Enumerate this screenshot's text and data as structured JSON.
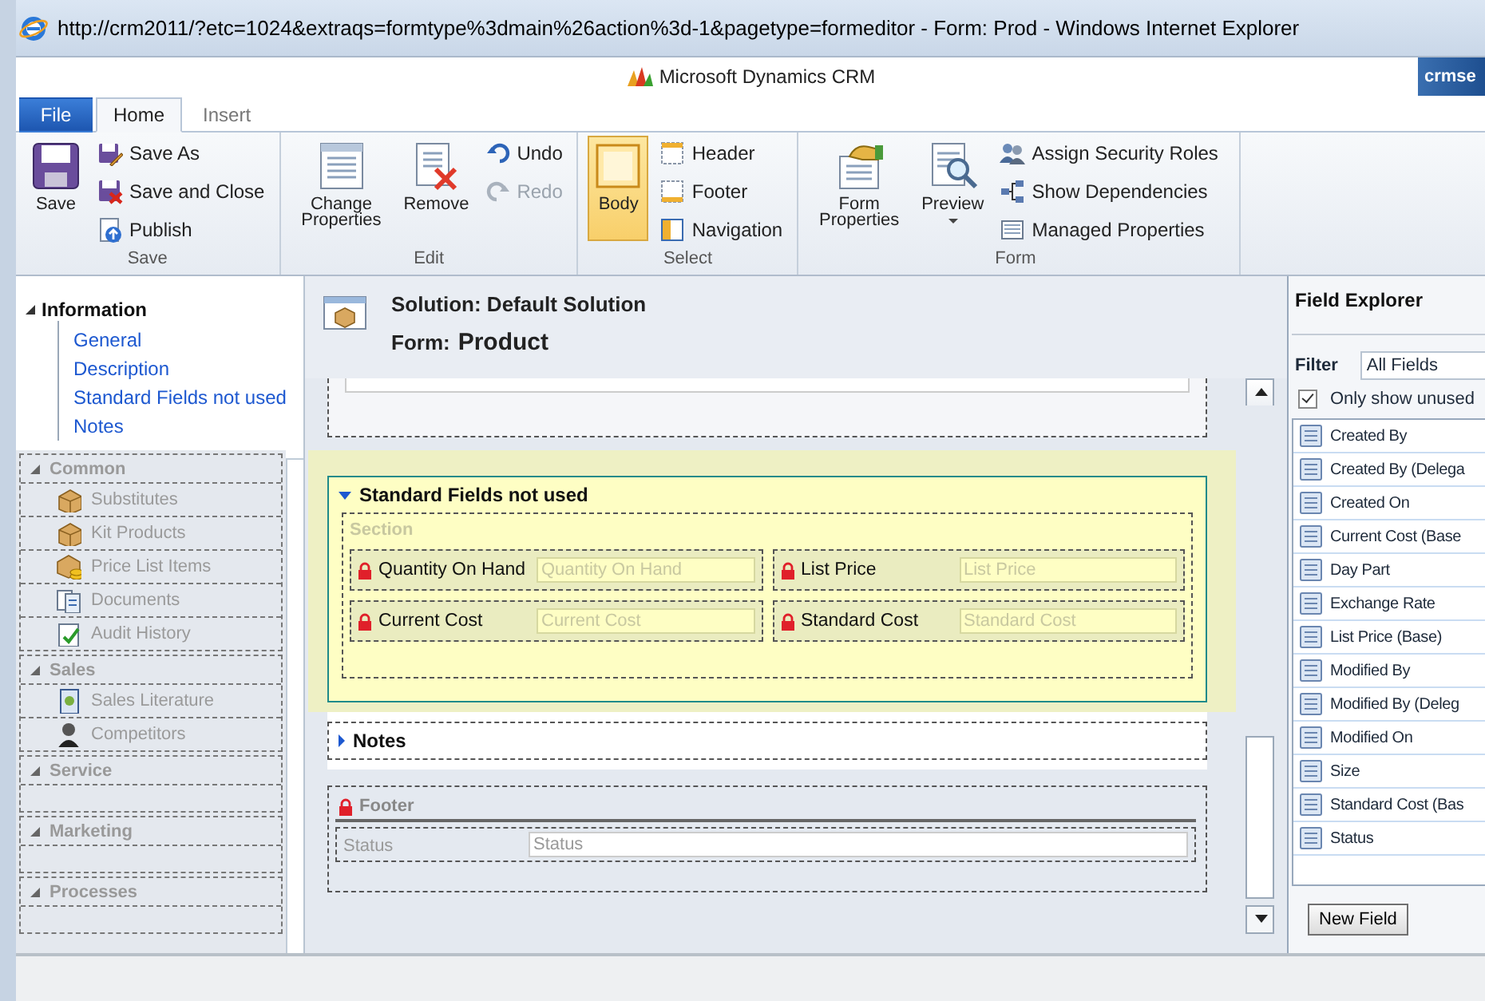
{
  "window": {
    "title": "http://crm2011/?etc=1024&extraqs=formtype%3dmain%26action%3d-1&pagetype=formeditor - Form: Prod - Windows Internet Explorer"
  },
  "header": {
    "product": "Microsoft Dynamics CRM",
    "user": "crmse"
  },
  "ribbon_tabs": [
    {
      "label": "File",
      "kind": "file",
      "selected": false
    },
    {
      "label": "Home",
      "kind": "tab",
      "selected": true
    },
    {
      "label": "Insert",
      "kind": "tab",
      "selected": false
    }
  ],
  "ribbon_groups": [
    {
      "label": "Save",
      "commands": [
        {
          "label": "Save",
          "kind": "large"
        },
        {
          "label": "Save As",
          "kind": "small"
        },
        {
          "label": "Save and Close",
          "kind": "small"
        },
        {
          "label": "Publish",
          "kind": "small"
        }
      ]
    },
    {
      "label": "Edit",
      "commands": [
        {
          "label": "Change Properties",
          "kind": "large"
        },
        {
          "label": "Remove",
          "kind": "large"
        },
        {
          "label": "Undo",
          "kind": "small",
          "disabled": false
        },
        {
          "label": "Redo",
          "kind": "small",
          "disabled": true
        }
      ]
    },
    {
      "label": "Select",
      "commands": [
        {
          "label": "Body",
          "kind": "large",
          "selected": true
        },
        {
          "label": "Header",
          "kind": "small",
          "selected": false
        },
        {
          "label": "Footer",
          "kind": "small",
          "selected": false
        },
        {
          "label": "Navigation",
          "kind": "small",
          "selected": false
        }
      ]
    },
    {
      "label": "Form",
      "commands": [
        {
          "label": "Form Properties",
          "kind": "large"
        },
        {
          "label": "Preview",
          "kind": "large",
          "dropdown": true
        },
        {
          "label": "Assign Security Roles",
          "kind": "small"
        },
        {
          "label": "Show Dependencies",
          "kind": "small"
        },
        {
          "label": "Managed Properties",
          "kind": "small"
        }
      ]
    }
  ],
  "nav_tree": {
    "label": "Information",
    "expanded": true,
    "children": [
      {
        "label": "General"
      },
      {
        "label": "Description"
      },
      {
        "label": "Standard Fields not used"
      },
      {
        "label": "Notes"
      }
    ]
  },
  "nav_groups": [
    {
      "label": "Common",
      "items": [
        {
          "label": "Substitutes"
        },
        {
          "label": "Kit Products"
        },
        {
          "label": "Price List Items"
        },
        {
          "label": "Documents"
        },
        {
          "label": "Audit History"
        }
      ]
    },
    {
      "label": "Sales",
      "items": [
        {
          "label": "Sales Literature"
        },
        {
          "label": "Competitors"
        }
      ]
    },
    {
      "label": "Service"
    },
    {
      "label": "Marketing"
    },
    {
      "label": "Processes"
    }
  ],
  "form_header": {
    "solution": "Solution: Default Solution",
    "form_label": "Form:",
    "form_name": "Product"
  },
  "tabs": [
    {
      "label": "Standard Fields not used",
      "expanded": true,
      "selected": true,
      "section": {
        "label": "Section",
        "fields": [
          {
            "label": "Quantity On Hand",
            "placeholder": "Quantity On Hand",
            "locked": true
          },
          {
            "label": "List Price",
            "placeholder": "List Price",
            "locked": true
          },
          {
            "label": "Current Cost",
            "placeholder": "Current Cost",
            "locked": true
          },
          {
            "label": "Standard Cost",
            "placeholder": "Standard Cost",
            "locked": true
          }
        ]
      }
    },
    {
      "label": "Notes",
      "expanded": false,
      "selected": false
    }
  ],
  "footer": {
    "label": "Footer",
    "locked": true,
    "fields": [
      {
        "label": "Status",
        "placeholder": "Status",
        "locked": false
      }
    ]
  },
  "field_explorer": {
    "title": "Field Explorer",
    "filter_label": "Filter",
    "filter_value": "All Fields",
    "only_unused": {
      "label": "Only show unused",
      "checked": true
    },
    "fields": [
      "Created By",
      "Created By (Delega",
      "Created On",
      "Current Cost (Base",
      "Day Part",
      "Exchange Rate",
      "List Price (Base)",
      "Modified By",
      "Modified By (Deleg",
      "Modified On",
      "Size",
      "Standard Cost (Bas",
      "Status"
    ],
    "new_button": "New Field"
  }
}
